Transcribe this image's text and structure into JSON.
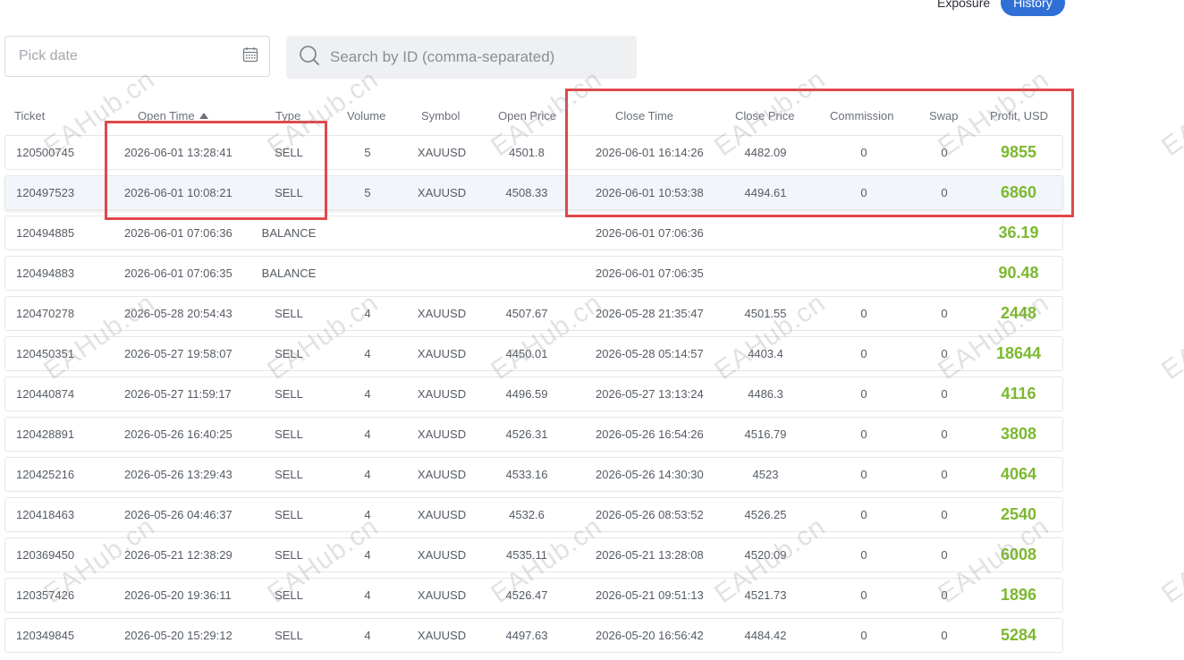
{
  "tabs": {
    "exposure": "Exposure",
    "history": "History"
  },
  "filters": {
    "date_placeholder": "Pick date",
    "search_placeholder": "Search by ID (comma-separated)"
  },
  "columns": {
    "ticket": "Ticket",
    "open_time": "Open Time",
    "type": "Type",
    "volume": "Volume",
    "symbol": "Symbol",
    "open_price": "Open Price",
    "close_time": "Close Time",
    "close_price": "Close Price",
    "commission": "Commission",
    "swap": "Swap",
    "profit": "Profit, USD"
  },
  "sort": {
    "column": "open_time",
    "direction": "ascending"
  },
  "watermark": "EAHub.cn",
  "rows": [
    {
      "ticket": "120500745",
      "open_time": "2026-06-01 13:28:41",
      "type": "SELL",
      "volume": "5",
      "symbol": "XAUUSD",
      "open_price": "4501.8",
      "close_time": "2026-06-01 16:14:26",
      "close_price": "4482.09",
      "commission": "0",
      "swap": "0",
      "profit": "9855"
    },
    {
      "ticket": "120497523",
      "open_time": "2026-06-01 10:08:21",
      "type": "SELL",
      "volume": "5",
      "symbol": "XAUUSD",
      "open_price": "4508.33",
      "close_time": "2026-06-01 10:53:38",
      "close_price": "4494.61",
      "commission": "0",
      "swap": "0",
      "profit": "6860"
    },
    {
      "ticket": "120494885",
      "open_time": "2026-06-01 07:06:36",
      "type": "BALANCE",
      "volume": "",
      "symbol": "",
      "open_price": "",
      "close_time": "2026-06-01 07:06:36",
      "close_price": "",
      "commission": "",
      "swap": "",
      "profit": "36.19"
    },
    {
      "ticket": "120494883",
      "open_time": "2026-06-01 07:06:35",
      "type": "BALANCE",
      "volume": "",
      "symbol": "",
      "open_price": "",
      "close_time": "2026-06-01 07:06:35",
      "close_price": "",
      "commission": "",
      "swap": "",
      "profit": "90.48"
    },
    {
      "ticket": "120470278",
      "open_time": "2026-05-28 20:54:43",
      "type": "SELL",
      "volume": "4",
      "symbol": "XAUUSD",
      "open_price": "4507.67",
      "close_time": "2026-05-28 21:35:47",
      "close_price": "4501.55",
      "commission": "0",
      "swap": "0",
      "profit": "2448"
    },
    {
      "ticket": "120450351",
      "open_time": "2026-05-27 19:58:07",
      "type": "SELL",
      "volume": "4",
      "symbol": "XAUUSD",
      "open_price": "4450.01",
      "close_time": "2026-05-28 05:14:57",
      "close_price": "4403.4",
      "commission": "0",
      "swap": "0",
      "profit": "18644"
    },
    {
      "ticket": "120440874",
      "open_time": "2026-05-27 11:59:17",
      "type": "SELL",
      "volume": "4",
      "symbol": "XAUUSD",
      "open_price": "4496.59",
      "close_time": "2026-05-27 13:13:24",
      "close_price": "4486.3",
      "commission": "0",
      "swap": "0",
      "profit": "4116"
    },
    {
      "ticket": "120428891",
      "open_time": "2026-05-26 16:40:25",
      "type": "SELL",
      "volume": "4",
      "symbol": "XAUUSD",
      "open_price": "4526.31",
      "close_time": "2026-05-26 16:54:26",
      "close_price": "4516.79",
      "commission": "0",
      "swap": "0",
      "profit": "3808"
    },
    {
      "ticket": "120425216",
      "open_time": "2026-05-26 13:29:43",
      "type": "SELL",
      "volume": "4",
      "symbol": "XAUUSD",
      "open_price": "4533.16",
      "close_time": "2026-05-26 14:30:30",
      "close_price": "4523",
      "commission": "0",
      "swap": "0",
      "profit": "4064"
    },
    {
      "ticket": "120418463",
      "open_time": "2026-05-26 04:46:37",
      "type": "SELL",
      "volume": "4",
      "symbol": "XAUUSD",
      "open_price": "4532.6",
      "close_time": "2026-05-26 08:53:52",
      "close_price": "4526.25",
      "commission": "0",
      "swap": "0",
      "profit": "2540"
    },
    {
      "ticket": "120369450",
      "open_time": "2026-05-21 12:38:29",
      "type": "SELL",
      "volume": "4",
      "symbol": "XAUUSD",
      "open_price": "4535.11",
      "close_time": "2026-05-21 13:28:08",
      "close_price": "4520.09",
      "commission": "0",
      "swap": "0",
      "profit": "6008"
    },
    {
      "ticket": "120357426",
      "open_time": "2026-05-20 19:36:11",
      "type": "SELL",
      "volume": "4",
      "symbol": "XAUUSD",
      "open_price": "4526.47",
      "close_time": "2026-05-21 09:51:13",
      "close_price": "4521.73",
      "commission": "0",
      "swap": "0",
      "profit": "1896"
    },
    {
      "ticket": "120349845",
      "open_time": "2026-05-20 15:29:12",
      "type": "SELL",
      "volume": "4",
      "symbol": "XAUUSD",
      "open_price": "4497.63",
      "close_time": "2026-05-20 16:56:42",
      "close_price": "4484.42",
      "commission": "0",
      "swap": "0",
      "profit": "5284"
    }
  ],
  "colors": {
    "accent": "#2f6fd6",
    "profit": "#7cb82f",
    "annotation_box": "#e0484b"
  }
}
